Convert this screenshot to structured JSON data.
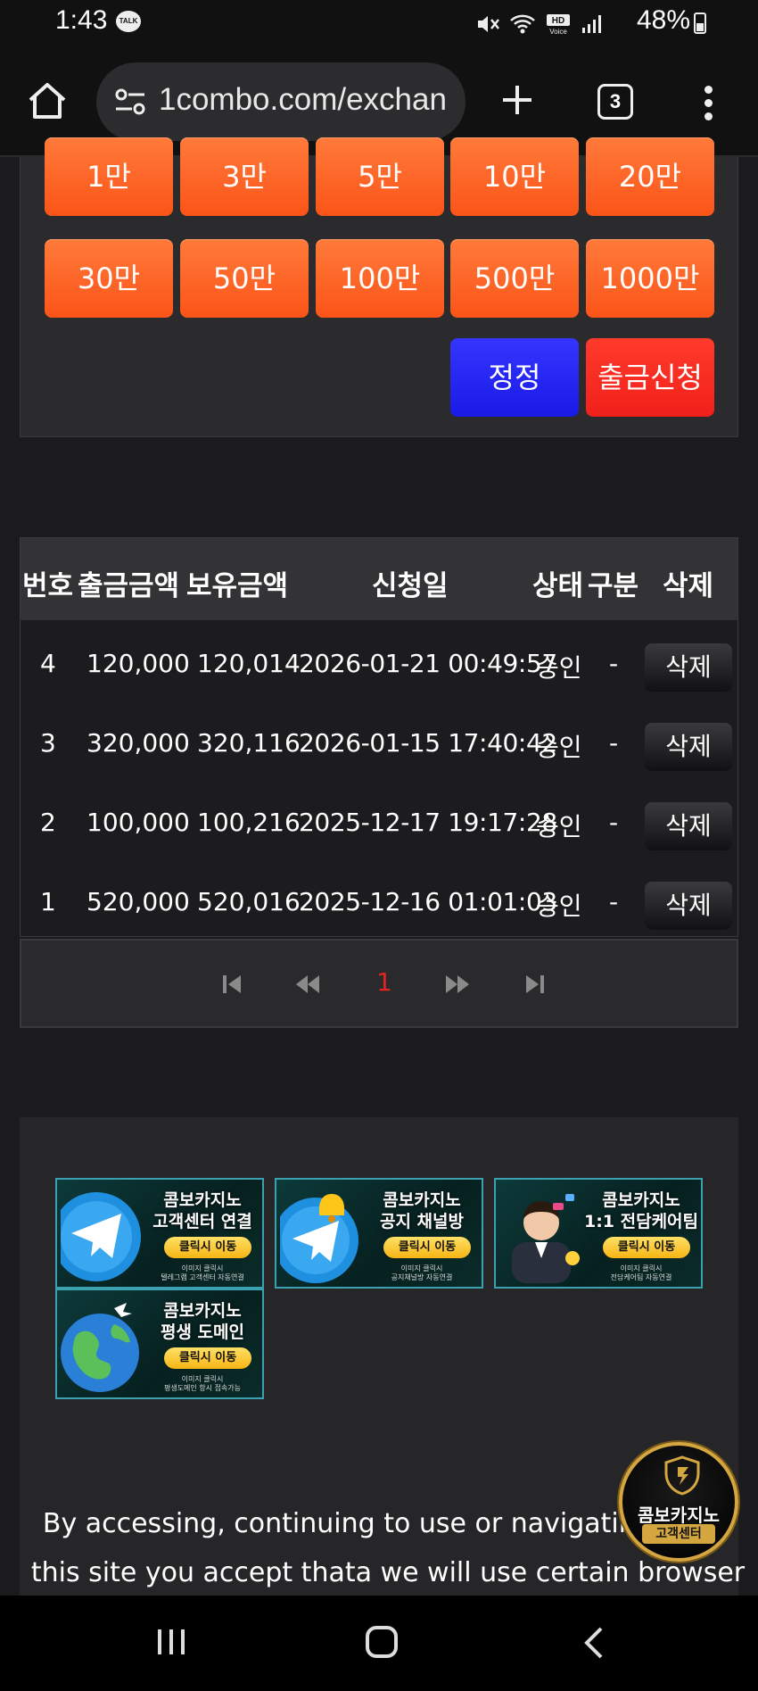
{
  "status_bar": {
    "time": "1:43",
    "talk_badge": "TALK",
    "battery": "48%",
    "hd_label": "HD"
  },
  "browser": {
    "url": "1combo.com/exchan",
    "tab_count": "3"
  },
  "amount_buttons": [
    "1만",
    "3만",
    "5만",
    "10만",
    "20만",
    "30만",
    "50만",
    "100만",
    "500만",
    "1000만"
  ],
  "actions": {
    "reset_label": "정정",
    "withdraw_label": "출금신청"
  },
  "table": {
    "headers": [
      "번호",
      "출금금액",
      "보유금액",
      "신청일",
      "상태",
      "구분",
      "삭제"
    ],
    "rows": [
      {
        "no": "4",
        "amount": "120,000",
        "balance": "120,014",
        "date": "2026-01-21 00:49:57",
        "status": "승인",
        "type": "-",
        "delete": "삭제"
      },
      {
        "no": "3",
        "amount": "320,000",
        "balance": "320,116",
        "date": "2026-01-15 17:40:42",
        "status": "승인",
        "type": "-",
        "delete": "삭제"
      },
      {
        "no": "2",
        "amount": "100,000",
        "balance": "100,216",
        "date": "2025-12-17 19:17:28",
        "status": "승인",
        "type": "-",
        "delete": "삭제"
      },
      {
        "no": "1",
        "amount": "520,000",
        "balance": "520,016",
        "date": "2025-12-16 01:01:03",
        "status": "승인",
        "type": "-",
        "delete": "삭제"
      }
    ]
  },
  "pagination": {
    "current_page": "1"
  },
  "banners": [
    {
      "line1": "콤보카지노",
      "line2": "고객센터 연결",
      "cta": "클릭시 이동",
      "sub1": "이미지 클릭시",
      "sub2": "텔레그램 고객센터 자동연결",
      "icon": "telegram-icon"
    },
    {
      "line1": "콤보카지노",
      "line2": "공지 채널방",
      "cta": "클릭시 이동",
      "sub1": "이미지 클릭시",
      "sub2": "공지채널방 자동연결",
      "icon": "telegram-bell-icon"
    },
    {
      "line1": "콤보카지노",
      "line2": "1:1 전담케어팀",
      "cta": "클릭시 이동",
      "sub1": "이미지 클릭시",
      "sub2": "전담케어팀 자동연결",
      "icon": "agent-avatar"
    },
    {
      "line1": "콤보카지노",
      "line2": "평생 도메인",
      "cta": "클릭시 이동",
      "sub1": "이미지 클릭시",
      "sub2": "평생도메인 항시 접속가능",
      "icon": "globe-icon"
    }
  ],
  "cookie_notice": {
    "line1": "By accessing, continuing to use or navigating thro",
    "line2": "this site you accept thata we will use certain browser"
  },
  "cs_badge": {
    "line1": "콤보카지노",
    "line2": "고객센터"
  },
  "colors": {
    "amount_button": "#fb5418",
    "reset_button": "#2222f0",
    "withdraw_button": "#f0261a",
    "current_page": "#e02424"
  }
}
